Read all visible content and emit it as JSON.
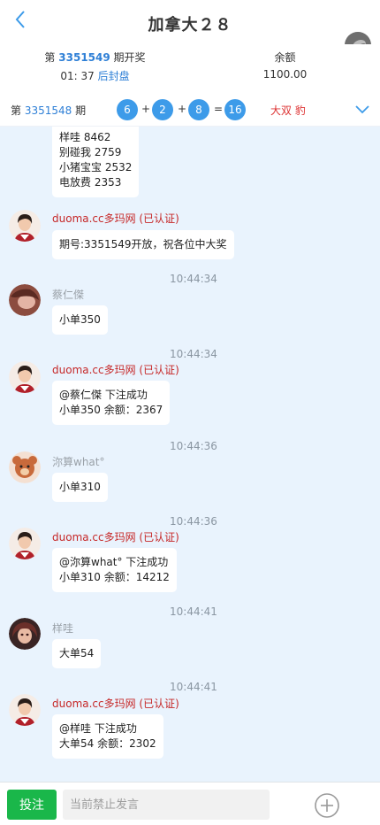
{
  "header": {
    "title": "加拿大２８"
  },
  "period": {
    "current_prefix": "第",
    "current_no": "3351549",
    "current_suffix": "期开奖",
    "countdown": "01: 37",
    "status": "后封盘",
    "balance_label": "余额",
    "balance": "1100.00"
  },
  "last_result": {
    "prefix": "第",
    "no": "3351548",
    "suffix": "期",
    "n1": "6",
    "plus1": "+",
    "n2": "2",
    "plus2": "+",
    "n3": "8",
    "eq": "=",
    "sum": "16",
    "text": "大双 豹"
  },
  "messages": {
    "m0": {
      "lines": [
        "样哇 8462",
        "别碰我 2759",
        "小猪宝宝 2532",
        "电放费 2353"
      ]
    },
    "m1": {
      "name": "duoma.cc多玛网 (已认证)",
      "text": "期号:3351549开放，祝各位中大奖"
    },
    "m2": {
      "time": "10:44:34",
      "name": "蔡仁傑",
      "text": "小单350"
    },
    "m3": {
      "time": "10:44:34",
      "name": "duoma.cc多玛网 (已认证)",
      "line1": "@蔡仁傑 下注成功",
      "line2": "小单350 余额：2367"
    },
    "m4": {
      "time": "10:44:36",
      "name": "沵算what°",
      "text": "小单310"
    },
    "m5": {
      "time": "10:44:36",
      "name": "duoma.cc多玛网 (已认证)",
      "line1": "@沵算what° 下注成功",
      "line2": "小单310 余额：14212"
    },
    "m6": {
      "time": "10:44:41",
      "name": "样哇",
      "text": "大单54"
    },
    "m7": {
      "time": "10:44:41",
      "name": "duoma.cc多玛网 (已认证)",
      "line1": "@样哇 下注成功",
      "line2": "大单54 余额：2302"
    }
  },
  "footer": {
    "bet_label": "投注",
    "input_placeholder": "当前禁止发言"
  },
  "colors": {
    "accent_blue": "#3d9be9",
    "bet_green": "#1ab74a",
    "system_red": "#c62828",
    "chat_bg": "#e9f3fd"
  }
}
